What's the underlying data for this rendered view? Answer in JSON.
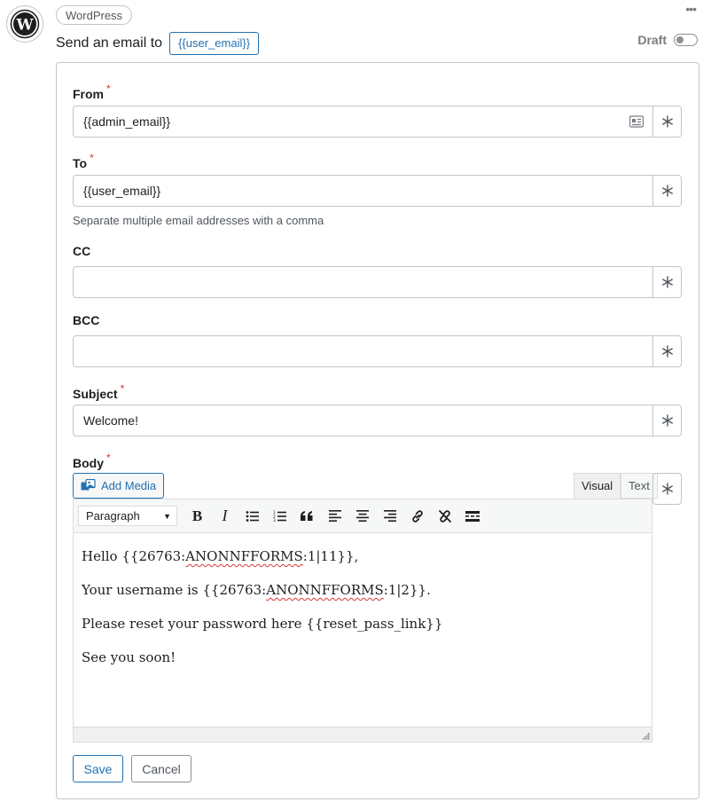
{
  "header": {
    "integration": "WordPress",
    "action_prefix": "Send an email to",
    "action_token": "{{user_email}}",
    "status_label": "Draft"
  },
  "fields": {
    "from": {
      "label": "From",
      "required": "*",
      "value": "{{admin_email}}"
    },
    "to": {
      "label": "To",
      "required": "*",
      "value": "{{user_email}}",
      "help": "Separate multiple email addresses with a comma"
    },
    "cc": {
      "label": "CC",
      "value": ""
    },
    "bcc": {
      "label": "BCC",
      "value": ""
    },
    "subject": {
      "label": "Subject",
      "required": "*",
      "value": "Welcome!"
    },
    "body": {
      "label": "Body",
      "required": "*"
    }
  },
  "editor": {
    "add_media": "Add Media",
    "tab_visual": "Visual",
    "tab_text": "Text",
    "format": "Paragraph",
    "content": {
      "line1_a": "Hello {{26763:",
      "line1_b": "ANONNFFORMS",
      "line1_c": ":1|11}},",
      "line2_a": "Your username is {{26763:",
      "line2_b": "ANONNFFORMS",
      "line2_c": ":1|2}}.",
      "line3": "Please reset your password here {{reset_pass_link}}",
      "line4": "See you soon!"
    }
  },
  "buttons": {
    "save": "Save",
    "cancel": "Cancel"
  },
  "colors": {
    "accent": "#2271b1",
    "required": "#d63638",
    "border": "#c3c4c7"
  }
}
